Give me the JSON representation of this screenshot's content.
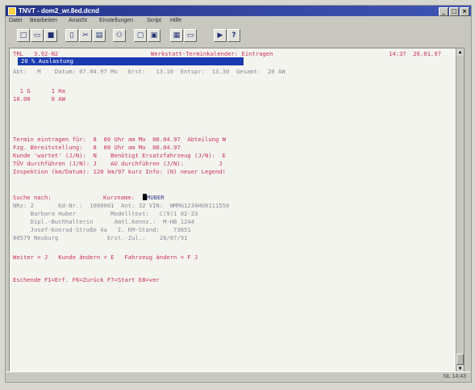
{
  "window": {
    "title": "TNVT - dom2_wr.8ed.dcnd"
  },
  "menu": [
    "Datei",
    "Bearbeiten",
    "Ansicht",
    "Einstellungen",
    "Script",
    "Hilfe"
  ],
  "toolbar": [
    {
      "icon": "new-icon",
      "glyph": "□"
    },
    {
      "icon": "open-icon",
      "glyph": "▭"
    },
    {
      "icon": "save-icon",
      "glyph": "■"
    },
    {
      "icon": "copy-icon",
      "glyph": "▯"
    },
    {
      "icon": "cut-icon",
      "glyph": "✂"
    },
    {
      "icon": "paste-icon",
      "glyph": "▤"
    },
    {
      "icon": "connect-icon",
      "glyph": "⚇"
    },
    {
      "icon": "macro-icon",
      "glyph": "▢"
    },
    {
      "icon": "print-icon",
      "glyph": "▣"
    },
    {
      "icon": "settings-icon",
      "glyph": "▦"
    },
    {
      "icon": "terminal-icon",
      "glyph": "▭"
    },
    {
      "icon": "next-icon",
      "glyph": "▶"
    },
    {
      "icon": "help-icon",
      "glyph": "?"
    }
  ],
  "terminal": {
    "header_left": "TRL   3.92-N2",
    "header_center": "Werkstatt-Terminkalender: Eintragen",
    "header_right": "14:37  26.01.97",
    "selected_row": "20 % Auslastung",
    "line_datum": "Abt:   M    Datum: 07.04.97 Mo   Erst:   13.10  Entspr:  13.30  Gesamt:  20 AW",
    "line_kap1": "  1 G      1 Ha",
    "line_kap2": "10.00      0 AW",
    "line_termin1": "Termin eintragen für:  8  00 Uhr am Mo  08.04.97  Abteilung W",
    "line_termin2": "Fzg. Bereitstellung:   8  00 Uhr am Mo  08.04.97",
    "line_kunde": "Kunde 'wartet' (J/N):  N    Benötigt Ersatzfahrzeug (J/N):  E",
    "line_tuev": "TÜV durchführen (J/N): J    AU durchführen (J/N):          J",
    "line_inspektion": "Inspektion (km/Datum): 120 km/97 kurz Info: (N) neuer Legend!",
    "line_suche_label": "Suche nach:",
    "line_suche_kurz": "Kurzname:",
    "line_suche_value": "MUBER",
    "line_nr": "NRz: 2       Kd-Nr.:  1000001  Ant: 32 VIN:  WMMG1234HU0111556",
    "line_name": "     Barbara Huber          Modelltext:   C(9)1 02-23",
    "line_beruf": "     Dipl.-Buchhalterin      Amtl.Kennz.:  M-HB 1244",
    "line_str": "     Josef-Konrad-Straße 4a   I. KM-Stand:    73651",
    "line_ort": "80579 Neuburg              Erst.-Zul.:    28/07/91",
    "line_weiter": "Weiter = J   Kunde ändern = E   Fahrzeug ändern = F J",
    "line_fkeys": "Eschende F1=Erf. F6=Zurück F7=Start E8=ver"
  },
  "status": {
    "text": "NL  14:43"
  }
}
